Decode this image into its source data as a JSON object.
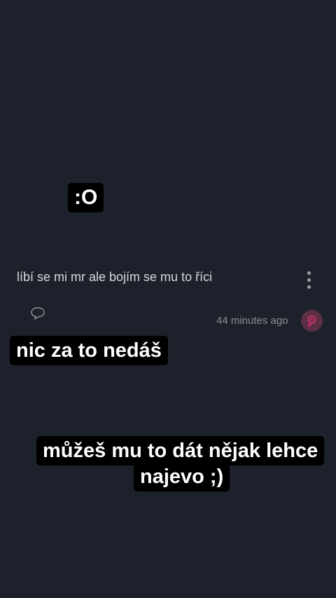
{
  "stickers": {
    "reaction": ":O",
    "reply_1": "nic za to nedáš",
    "reply_2_line_1": "můžeš mu to dát nějak lehce",
    "reply_2_line_2": "najevo ;)"
  },
  "post": {
    "text": "líbí se mi mr ale bojím se mu to říci",
    "timestamp": "44 minutes ago"
  },
  "icons": {
    "more": "more-vertical-icon",
    "comment": "comment-bubble-icon",
    "avatar": "user-avatar-icon"
  },
  "colors": {
    "background": "#1c212b",
    "sticker_background": "#000000",
    "avatar_background": "#5b3044",
    "avatar_accent": "#e0327a"
  }
}
